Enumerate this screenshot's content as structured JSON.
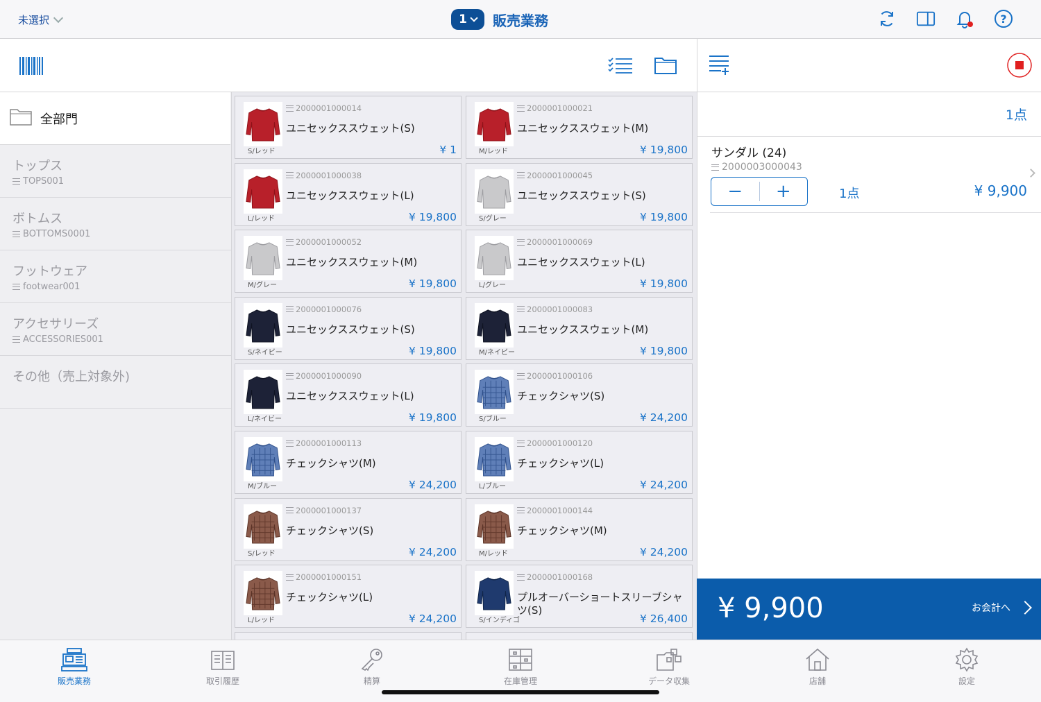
{
  "topbar": {
    "staff": "未選択",
    "register_number": "1",
    "title": "販売業務"
  },
  "colors": {
    "accent": "#1a73c8",
    "total_bar": "#0b5cab",
    "stop": "#e02020"
  },
  "sidebar": {
    "all_label": "全部門",
    "categories": [
      {
        "name": "トップス",
        "code": "TOPS001"
      },
      {
        "name": "ボトムス",
        "code": "BOTTOMS0001"
      },
      {
        "name": "フットウェア",
        "code": "footwear001"
      },
      {
        "name": "アクセサリーズ",
        "code": "ACCESSORIES001"
      },
      {
        "name": "その他（売上対象外)",
        "code": ""
      }
    ]
  },
  "products": [
    {
      "code": "2000001000014",
      "name": "ユニセックススウェット(S)",
      "variant": "S/レッド",
      "price": "¥ 1",
      "thumb": "red-sweater"
    },
    {
      "code": "2000001000021",
      "name": "ユニセックススウェット(M)",
      "variant": "M/レッド",
      "price": "¥ 19,800",
      "thumb": "red-sweater"
    },
    {
      "code": "2000001000038",
      "name": "ユニセックススウェット(L)",
      "variant": "L/レッド",
      "price": "¥ 19,800",
      "thumb": "red-sweater"
    },
    {
      "code": "2000001000045",
      "name": "ユニセックススウェット(S)",
      "variant": "S/グレー",
      "price": "¥ 19,800",
      "thumb": "gray-sweater"
    },
    {
      "code": "2000001000052",
      "name": "ユニセックススウェット(M)",
      "variant": "M/グレー",
      "price": "¥ 19,800",
      "thumb": "gray-sweater"
    },
    {
      "code": "2000001000069",
      "name": "ユニセックススウェット(L)",
      "variant": "L/グレー",
      "price": "¥ 19,800",
      "thumb": "gray-sweater"
    },
    {
      "code": "2000001000076",
      "name": "ユニセックススウェット(S)",
      "variant": "S/ネイビー",
      "price": "¥ 19,800",
      "thumb": "navy-sweater"
    },
    {
      "code": "2000001000083",
      "name": "ユニセックススウェット(M)",
      "variant": "M/ネイビー",
      "price": "¥ 19,800",
      "thumb": "navy-sweater"
    },
    {
      "code": "2000001000090",
      "name": "ユニセックススウェット(L)",
      "variant": "L/ネイビー",
      "price": "¥ 19,800",
      "thumb": "navy-sweater"
    },
    {
      "code": "2000001000106",
      "name": "チェックシャツ(S)",
      "variant": "S/ブルー",
      "price": "¥ 24,200",
      "thumb": "blue-check-shirt"
    },
    {
      "code": "2000001000113",
      "name": "チェックシャツ(M)",
      "variant": "M/ブルー",
      "price": "¥ 24,200",
      "thumb": "blue-check-shirt"
    },
    {
      "code": "2000001000120",
      "name": "チェックシャツ(L)",
      "variant": "L/ブルー",
      "price": "¥ 24,200",
      "thumb": "blue-check-shirt"
    },
    {
      "code": "2000001000137",
      "name": "チェックシャツ(S)",
      "variant": "S/レッド",
      "price": "¥ 24,200",
      "thumb": "brown-check-shirt"
    },
    {
      "code": "2000001000144",
      "name": "チェックシャツ(M)",
      "variant": "M/レッド",
      "price": "¥ 24,200",
      "thumb": "brown-check-shirt"
    },
    {
      "code": "2000001000151",
      "name": "チェックシャツ(L)",
      "variant": "L/レッド",
      "price": "¥ 24,200",
      "thumb": "brown-check-shirt"
    },
    {
      "code": "2000001000168",
      "name": "プルオーバーショートスリーブシャツ(S)",
      "variant": "S/インディゴ",
      "price": "¥ 26,400",
      "thumb": "indigo-polo"
    }
  ],
  "cart": {
    "total_count": "1点",
    "items": [
      {
        "name": "サンダル (24)",
        "code": "2000003000043",
        "qty": "1点",
        "price": "¥ 9,900"
      }
    ],
    "total": "¥ 9,900",
    "checkout_label": "お会計へ"
  },
  "nav": [
    {
      "label": "販売業務",
      "icon": "register-icon",
      "active": true
    },
    {
      "label": "取引履歴",
      "icon": "history-icon"
    },
    {
      "label": "精算",
      "icon": "key-icon"
    },
    {
      "label": "在庫管理",
      "icon": "inventory-icon"
    },
    {
      "label": "データ収集",
      "icon": "data-collection-icon"
    },
    {
      "label": "店舗",
      "icon": "store-icon"
    },
    {
      "label": "設定",
      "icon": "settings-icon"
    }
  ]
}
